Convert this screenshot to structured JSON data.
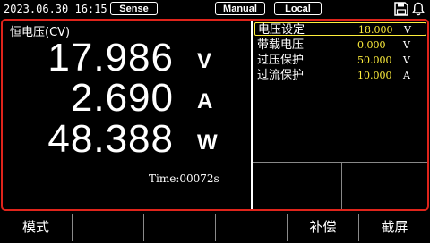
{
  "status_bar": {
    "datetime": "2023.06.30 16:15",
    "sense_label": "Sense",
    "mode_label": "Manual",
    "control_label": "Local",
    "icons": [
      "save-icon",
      "bell-icon"
    ]
  },
  "measure": {
    "mode": "恒电压(CV)",
    "voltage": {
      "value": "17.986",
      "unit": "V"
    },
    "current": {
      "value": "2.690",
      "unit": "A"
    },
    "power": {
      "value": "48.388",
      "unit": "W"
    },
    "time_text": "Time:00072s"
  },
  "params": [
    {
      "label": "电压设定",
      "value": "18.000",
      "unit": "V"
    },
    {
      "label": "带载电压",
      "value": "0.000",
      "unit": "V"
    },
    {
      "label": "过压保护",
      "value": "50.000",
      "unit": "V"
    },
    {
      "label": "过流保护",
      "value": "10.000",
      "unit": "A"
    }
  ],
  "softkeys": [
    "模式",
    "",
    "",
    "",
    "补偿",
    "截屏"
  ],
  "colors": {
    "frame": "#e0241b",
    "param_value": "#ffef3c",
    "background": "#000000"
  }
}
